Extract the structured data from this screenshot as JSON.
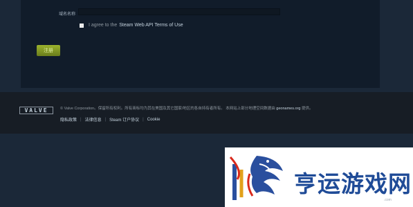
{
  "form": {
    "domain_label": "域名名称",
    "domain_value": "",
    "agree_prefix": "I agree to the",
    "terms_link": "Steam Web API Terms of Use",
    "register_button": "注册"
  },
  "footer": {
    "logo_text": "VALVE",
    "copyright_prefix": "© Valve Corporation。保留所有权利。所有商标均为其在美国及其它国家/地区的各自持有者所有。 本网站上部分地理空间数据由",
    "geonames": "geonames.org",
    "copyright_suffix": "提供。",
    "links": [
      "隐私政策",
      "法律信息",
      "Steam 订户协议",
      "Cookie"
    ],
    "separator": "|"
  },
  "watermark": {
    "text": "亨运游戏网",
    "url": ".com"
  },
  "colors": {
    "page_bg": "#1b2838",
    "panel_bg": "#111c2a",
    "footer_bg": "#171d25",
    "button_green": "#8ba52a",
    "watermark_blue": "#1f4b97"
  }
}
